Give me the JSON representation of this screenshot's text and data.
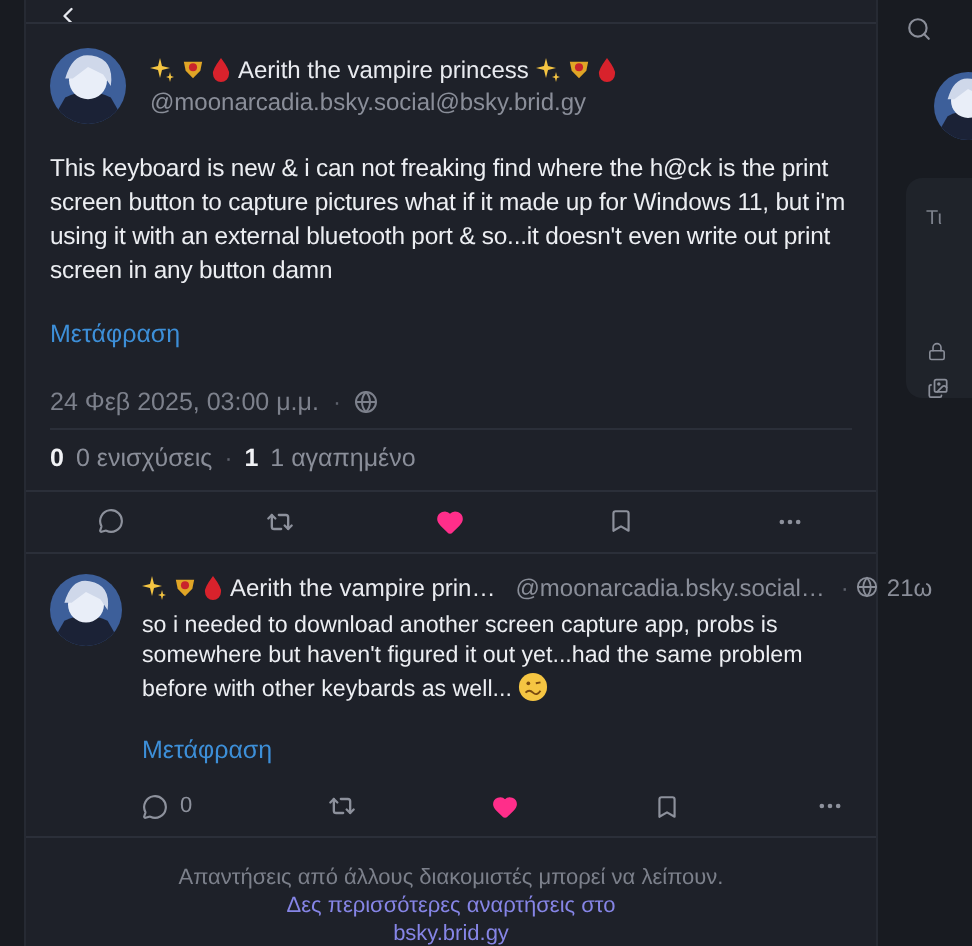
{
  "post": {
    "display_name": "Aerith the vampire princess",
    "handle": "@moonarcadia.bsky.social@bsky.brid.gy",
    "text": "This keyboard is new & i can not freaking find where the h@ck is the print screen button to capture pictures what if it made up for Windows 11, but i'm using it with an external bluetooth port & so...it doesn't even write out print screen in any button damn",
    "translate": "Μετάφραση",
    "date": "24 Φεβ 2025, 03:00 μ.μ.",
    "separator": "·",
    "stats": [
      {
        "count": "0",
        "label": "0 ενισχύσεις"
      },
      {
        "count": "1",
        "label": "1 αγαπημένο"
      }
    ],
    "liked": true
  },
  "reply": {
    "display_name": "Aerith the vampire prin…",
    "handle": "@moonarcadia.bsky.social…",
    "separator": "·",
    "time": "21ω",
    "text": "so i needed to download another screen capture app, probs is somewhere but haven't figured it out yet...had the same problem before with other keybards as well...",
    "translate": "Μετάφραση",
    "reply_count": "0",
    "liked": true
  },
  "footer": {
    "note": "Απαντήσεις από άλλους διακομιστές μπορεί να λείπουν.",
    "link_lines": [
      "Δες περισσότερες αναρτήσεις στο",
      "bsky.brid.gy"
    ]
  },
  "side_panel": {
    "label": "Τι"
  }
}
